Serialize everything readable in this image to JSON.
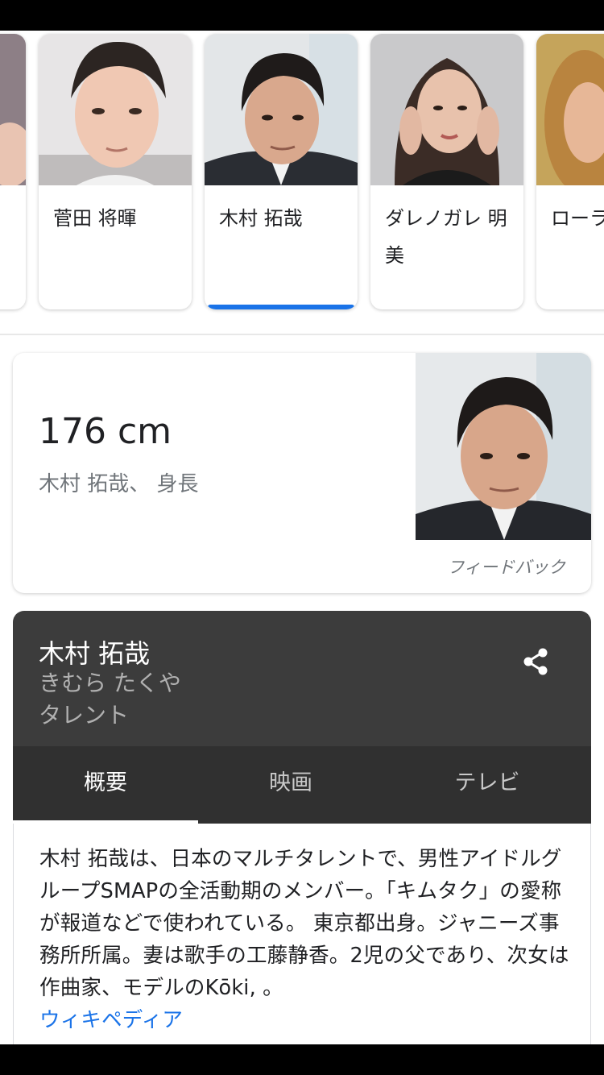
{
  "carousel": {
    "items": [
      {
        "name": "",
        "photo": "partial-person-photo"
      },
      {
        "name": "菅田 将暉",
        "photo": "person-photo"
      },
      {
        "name": "木村 拓哉",
        "photo": "person-photo",
        "selected": true
      },
      {
        "name": "ダレノガレ 明美",
        "photo": "person-photo"
      },
      {
        "name": "ローラ",
        "photo": "person-photo"
      }
    ]
  },
  "answer": {
    "value": "176 cm",
    "subtitle": "木村 拓哉、 身長",
    "feedback": "フィードバック"
  },
  "knowledge_panel": {
    "title": "木村 拓哉",
    "reading": "きむら たくや",
    "type": "タレント",
    "share_icon": "share-icon",
    "tabs": [
      {
        "label": "概要",
        "active": true
      },
      {
        "label": "映画",
        "active": false
      },
      {
        "label": "テレビ",
        "active": false
      }
    ],
    "description": "木村 拓哉は、日本のマルチタレントで、男性アイドルグループSMAPの全活動期のメンバー。「キムタク」の愛称が報道などで使われている。 東京都出身。ジャニーズ事務所所属。妻は歌手の工藤静香。2児の父であり、次女は作曲家、モデルのKōki, 。",
    "source_link": "ウィキペディア"
  },
  "colors": {
    "accent": "#1a73e8",
    "panel_header": "#3c3c3c",
    "panel_tabs": "#303030"
  }
}
